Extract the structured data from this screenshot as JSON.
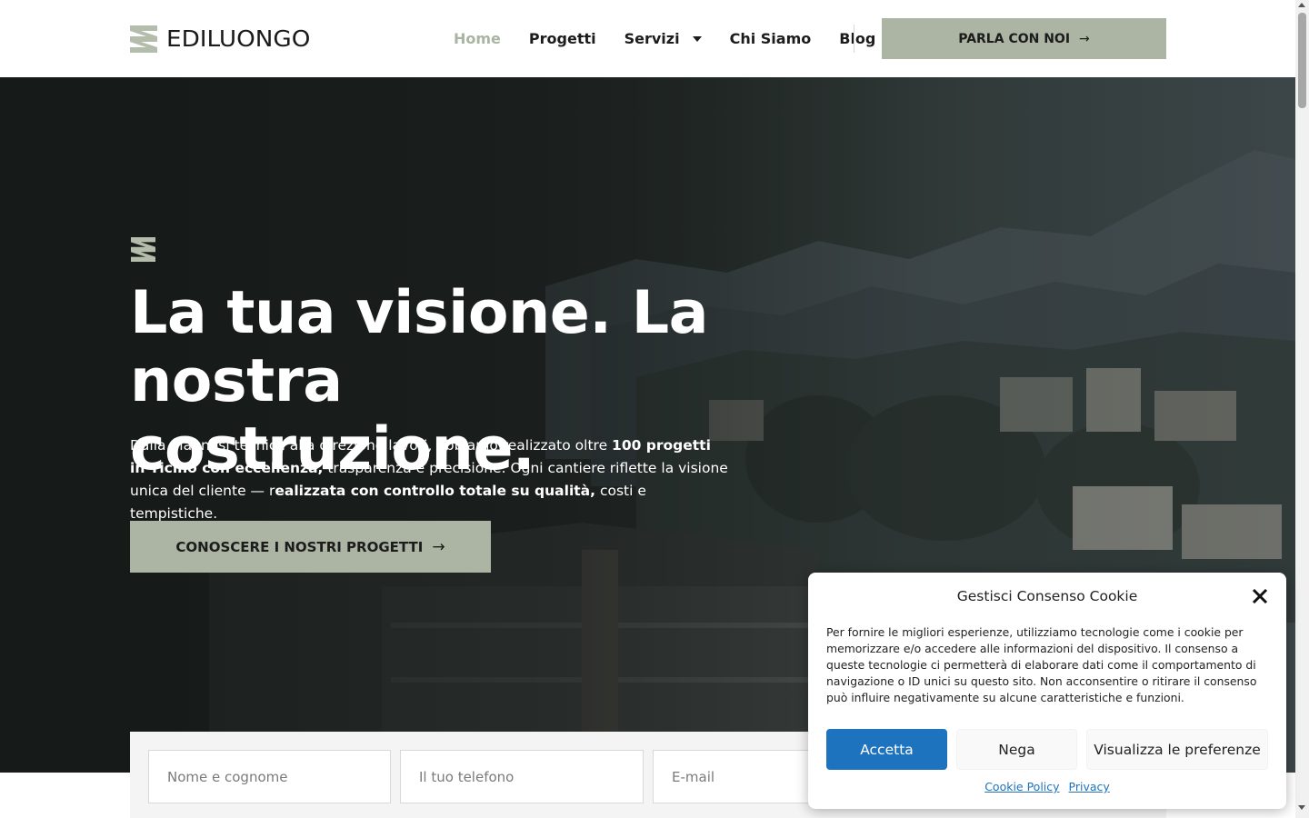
{
  "header": {
    "logo_text": "EDILUONGO",
    "nav": {
      "home": "Home",
      "progetti": "Progetti",
      "servizi": "Servizi",
      "chi_siamo": "Chi Siamo",
      "blog": "Blog"
    },
    "cta_label": "PARLA CON NOI",
    "cta_arrow": "→"
  },
  "hero": {
    "title": "La tua visione. La nostra costruzione.",
    "desc": {
      "p1": "Dalla diagnosi tecnica alla direzione lavori, abbiamo realizzato oltre ",
      "b1": "100 progetti in Ticino con eccellenza,",
      "p2": " trasparenza e precisione. Ogni cantiere riflette la visione unica del cliente — r",
      "b2": "ealizzata con controllo totale su qualità,",
      "p3": " costi e tempistiche."
    },
    "cta_label": "CONOSCERE I NOSTRI PROGETTI",
    "cta_arrow": "→"
  },
  "form": {
    "name_placeholder": "Nome e cognome",
    "phone_placeholder": "Il tuo telefono",
    "email_placeholder": "E-mail"
  },
  "cookie": {
    "title": "Gestisci Consenso Cookie",
    "text": "Per fornire le migliori esperienze, utilizziamo tecnologie come i cookie per memorizzare e/o accedere alle informazioni del dispositivo. Il consenso a queste tecnologie ci permetterà di elaborare dati come il comportamento di navigazione o ID unici su questo sito. Non acconsentire o ritirare il consenso può influire negativamente su alcune caratteristiche e funzioni.",
    "accept": "Accetta",
    "deny": "Nega",
    "prefs": "Visualizza le preferenze",
    "link_cookie_policy": "Cookie Policy",
    "link_privacy": "Privacy"
  },
  "colors": {
    "accent": "#acb5a3",
    "nav_active": "#a9b4a1",
    "cookie_button": "#1e73be"
  }
}
